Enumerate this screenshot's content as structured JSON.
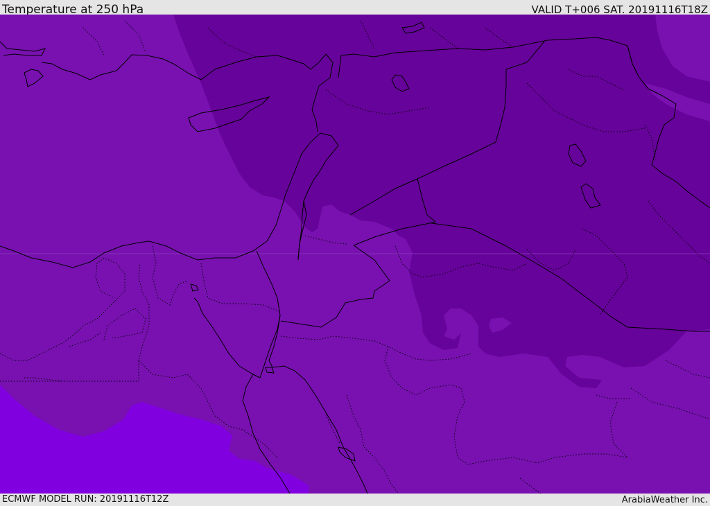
{
  "header": {
    "title": "Temperature at 250 hPa",
    "valid_time": "VALID T+006 SAT. 20191116T18Z"
  },
  "footer": {
    "model_run": "ECMWF MODEL RUN: 20191116T12Z",
    "credit": "ArabiaWeather Inc."
  },
  "colors": {
    "band_cold": "#66039a",
    "band_mid": "#7811b0",
    "band_warm": "#8000e0",
    "coastline": "#000000",
    "background": "#e5e5e5"
  }
}
